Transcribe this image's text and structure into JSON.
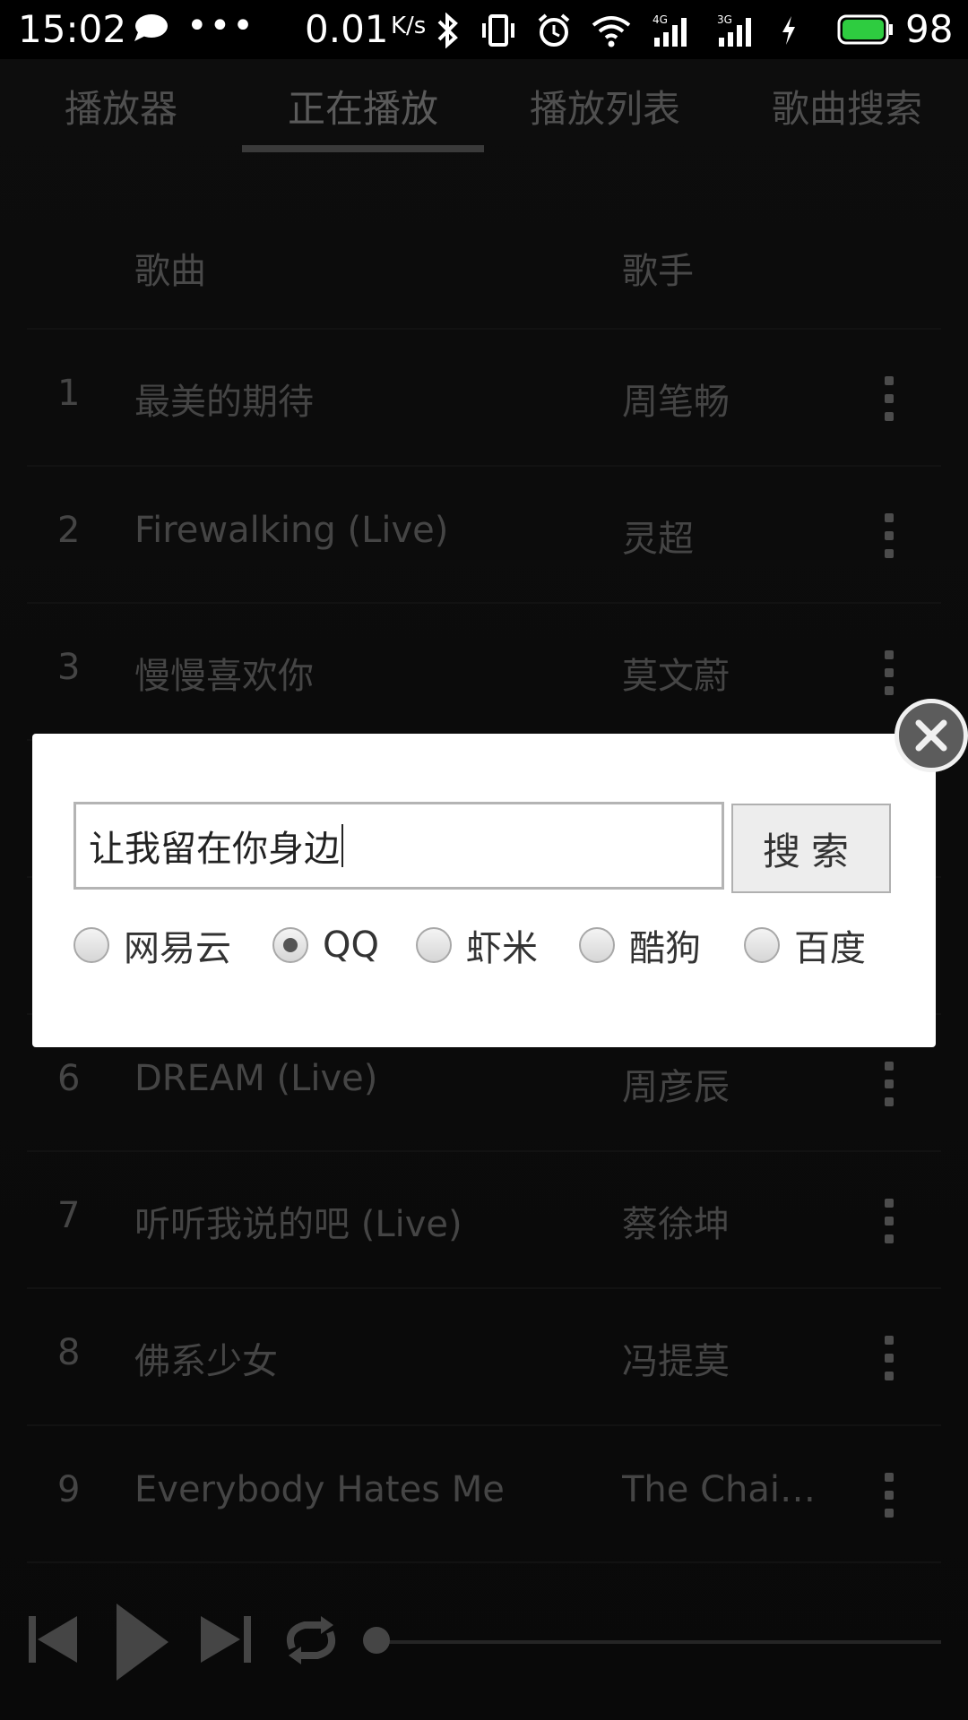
{
  "status_bar": {
    "time": "15:02",
    "more": "•••",
    "net_speed": "0.01",
    "net_unit": "K/s",
    "battery": "98",
    "icons": [
      "chat-bubble-icon",
      "bluetooth-icon",
      "vibrate-icon",
      "alarm-icon",
      "wifi-icon",
      "signal-4g-icon",
      "signal-3g-icon",
      "charging-icon",
      "battery-icon"
    ],
    "battery_color": "#2ecc40"
  },
  "tabs": [
    {
      "label": "播放器"
    },
    {
      "label": "正在播放"
    },
    {
      "label": "播放列表"
    },
    {
      "label": "歌曲搜索"
    }
  ],
  "active_tab": "正在播放",
  "list": {
    "header": {
      "song": "歌曲",
      "artist": "歌手"
    },
    "rows": [
      {
        "index": "1",
        "song": "最美的期待",
        "artist": "周笔畅"
      },
      {
        "index": "2",
        "song": "Firewalking (Live)",
        "artist": "灵超"
      },
      {
        "index": "3",
        "song": "慢慢喜欢你",
        "artist": "莫文蔚"
      },
      {
        "index": "",
        "song": "",
        "artist": ""
      },
      {
        "index": "",
        "song": "",
        "artist": ""
      },
      {
        "index": "6",
        "song": "DREAM (Live)",
        "artist": "周彦辰"
      },
      {
        "index": "7",
        "song": "听听我说的吧 (Live)",
        "artist": "蔡徐坤"
      },
      {
        "index": "8",
        "song": "佛系少女",
        "artist": "冯提莫"
      },
      {
        "index": "9",
        "song": "Everybody Hates Me",
        "artist": "The Chainsmokers"
      }
    ]
  },
  "player": {
    "controls": [
      "previous-icon",
      "play-icon",
      "next-icon",
      "repeat-icon"
    ],
    "progress": 0.0
  },
  "dialog": {
    "search_value": "让我留在你身边",
    "search_button": "搜索",
    "sources": [
      {
        "label": "网易云",
        "checked": false
      },
      {
        "label": "QQ",
        "checked": true
      },
      {
        "label": "虾米",
        "checked": false
      },
      {
        "label": "酷狗",
        "checked": false
      },
      {
        "label": "百度",
        "checked": false
      }
    ]
  }
}
